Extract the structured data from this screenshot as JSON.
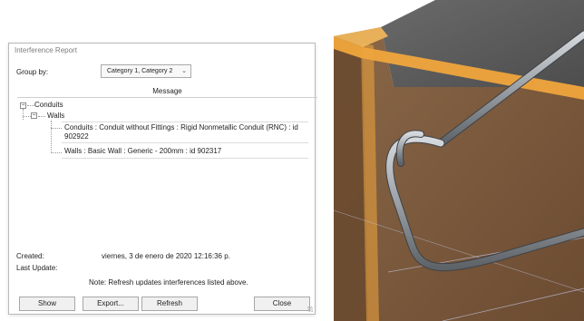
{
  "dialog": {
    "title": "Interference Report",
    "group_by_label": "Group by:",
    "group_by_value": "Category 1, Category 2",
    "message_header": "Message",
    "tree": {
      "category": "Conduits",
      "sub_category": "Walls",
      "items": [
        "Conduits : Conduit without Fittings : Rigid Nonmetallic Conduit (RNC) : id 902922",
        "Walls : Basic Wall : Generic - 200mm : id 902317"
      ]
    },
    "created_label": "Created:",
    "created_value": "viernes, 3 de enero de 2020 12:16:36 p.",
    "last_update_label": "Last Update:",
    "last_update_value": "",
    "note": "Note: Refresh updates interferences listed above.",
    "buttons": {
      "show": "Show",
      "export": "Export...",
      "refresh": "Refresh",
      "close": "Close"
    }
  },
  "colors": {
    "highlight_edge": "#f0a53c",
    "wall_brown": "#7a5a3e",
    "wall_top": "#5a5a5a",
    "conduit": "#9aa0a6"
  },
  "icons": {
    "collapse": "minus-box-icon",
    "dropdown": "chevron-down-icon"
  }
}
